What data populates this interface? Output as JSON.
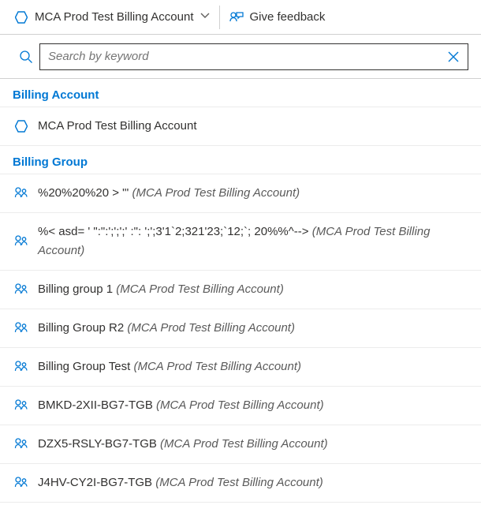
{
  "header": {
    "account": "MCA Prod Test Billing Account",
    "feedback": "Give feedback"
  },
  "search": {
    "placeholder": "Search by keyword"
  },
  "sections": {
    "billing_account": {
      "title": "Billing Account",
      "items": [
        {
          "label": "MCA Prod Test Billing Account",
          "context": ""
        }
      ]
    },
    "billing_group": {
      "title": "Billing Group",
      "items": [
        {
          "label": "%20%20%20 > \"' ",
          "context": "(MCA Prod Test Billing Account)"
        },
        {
          "label": "%< asd= ' \":\":';';';' :\": ';';3'1`2;321'23;`12;`; 20%%^--> ",
          "context": "(MCA Prod Test Billing Account)"
        },
        {
          "label": "Billing group 1 ",
          "context": "(MCA Prod Test Billing Account)"
        },
        {
          "label": "Billing Group R2 ",
          "context": "(MCA Prod Test Billing Account)"
        },
        {
          "label": "Billing Group Test ",
          "context": "(MCA Prod Test Billing Account)"
        },
        {
          "label": "BMKD-2XII-BG7-TGB ",
          "context": "(MCA Prod Test Billing Account)"
        },
        {
          "label": "DZX5-RSLY-BG7-TGB ",
          "context": "(MCA Prod Test Billing Account)"
        },
        {
          "label": "J4HV-CY2I-BG7-TGB ",
          "context": "(MCA Prod Test Billing Account)"
        }
      ]
    }
  }
}
